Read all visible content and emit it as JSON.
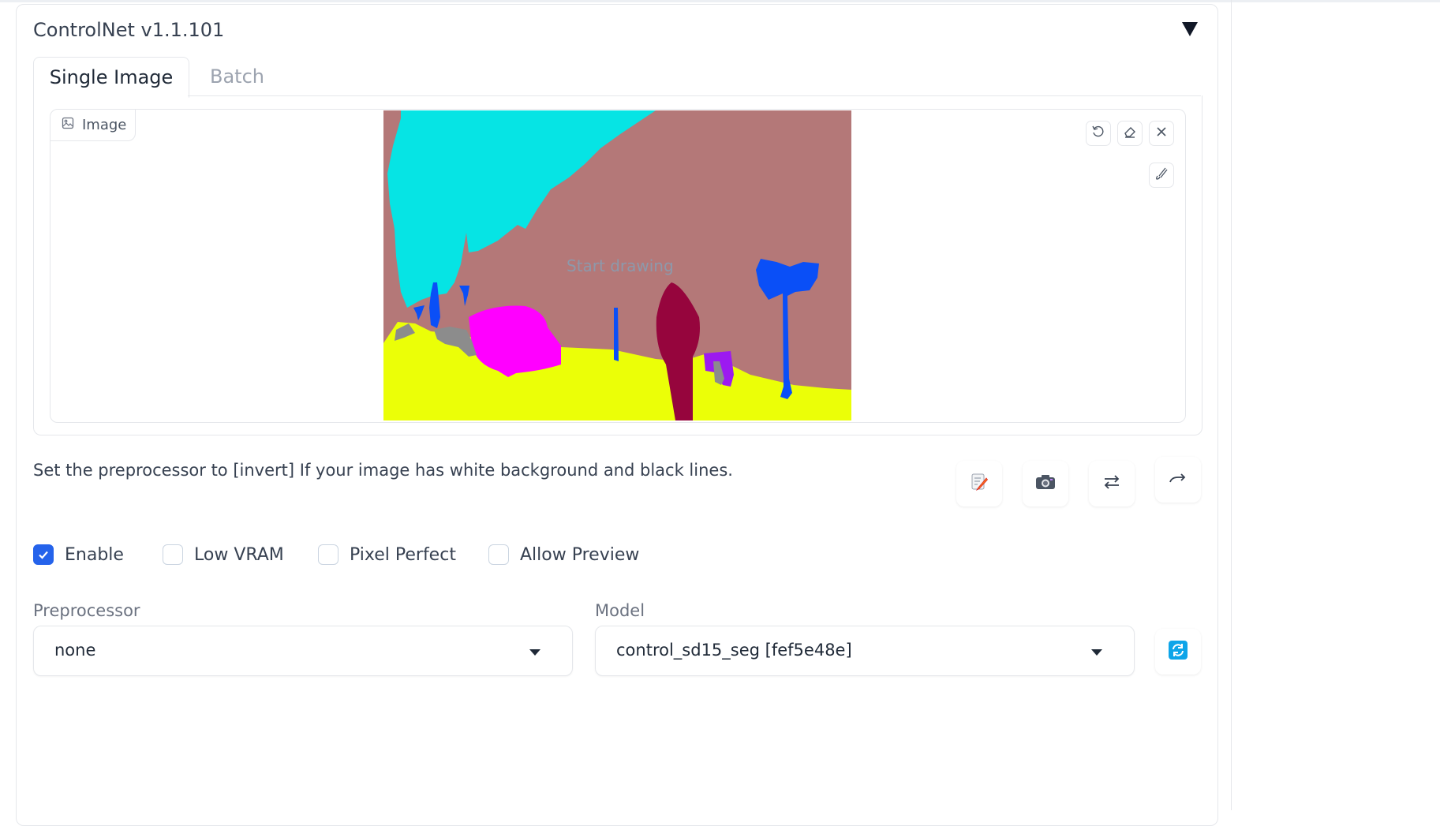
{
  "panel": {
    "title": "ControlNet v1.1.101",
    "collapse_icon": "triangle-down-icon"
  },
  "tabs": [
    {
      "label": "Single Image",
      "active": true
    },
    {
      "label": "Batch",
      "active": false
    }
  ],
  "image_input": {
    "label": "Image",
    "placeholder": "Start drawing",
    "tools": [
      "undo-icon",
      "eraser-icon",
      "close-icon",
      "brush-icon"
    ],
    "segmentation_colors": {
      "sky": "#06e4e4",
      "mountain": "#b47878",
      "ground": "#ebff07",
      "tree": "#0a4ff7",
      "rock": "#ff00ff",
      "person": "#96053d",
      "plant": "#9c1af0",
      "stone": "#8c8c8c"
    }
  },
  "hint": "Set the preprocessor to [invert] If your image has white background and black lines.",
  "toolbar": [
    "edit-icon",
    "camera-icon",
    "swap-icon",
    "send-up-icon"
  ],
  "checkboxes": [
    {
      "label": "Enable",
      "checked": true
    },
    {
      "label": "Low VRAM",
      "checked": false
    },
    {
      "label": "Pixel Perfect",
      "checked": false
    },
    {
      "label": "Allow Preview",
      "checked": false
    }
  ],
  "preprocessor": {
    "label": "Preprocessor",
    "value": "none"
  },
  "model": {
    "label": "Model",
    "value": "control_sd15_seg [fef5e48e]",
    "refresh_icon": "refresh-icon"
  },
  "colors": {
    "accent": "#2563eb",
    "border": "#e5e7eb"
  }
}
